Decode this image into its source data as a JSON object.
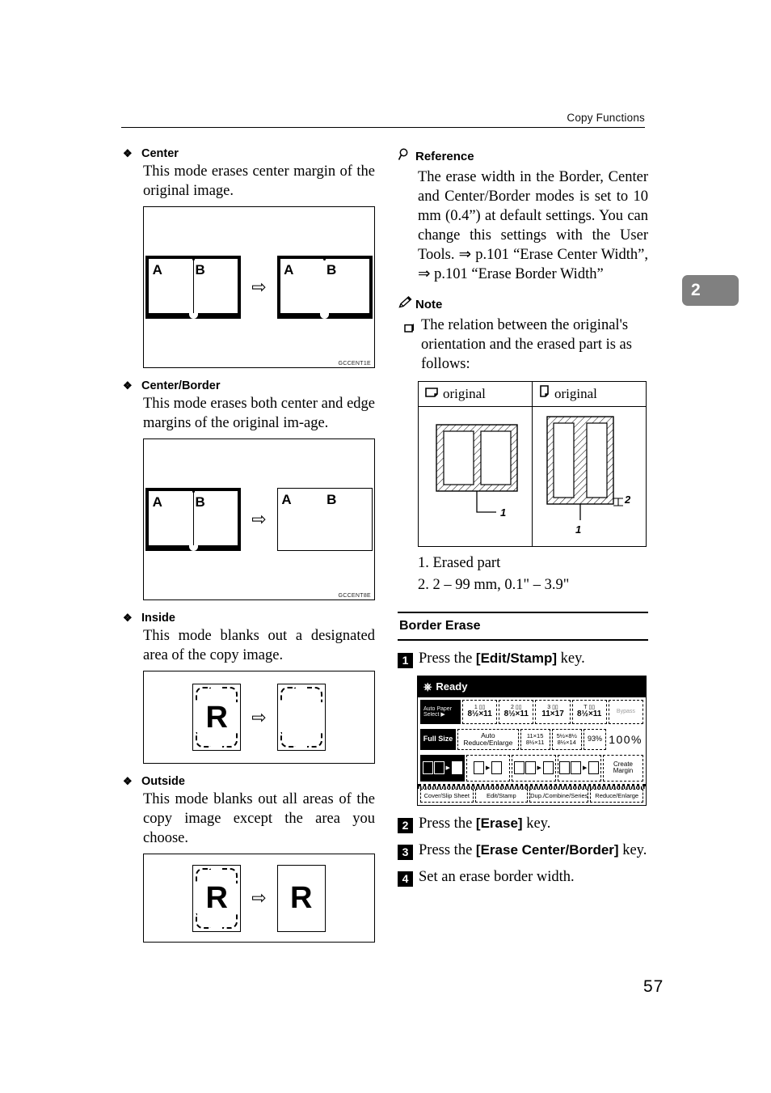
{
  "header": {
    "running_head": "Copy Functions"
  },
  "chapter_tab": {
    "number": "2"
  },
  "page_number": "57",
  "left_column": {
    "sections": [
      {
        "bullet": "❖",
        "title": "Center",
        "body": "This mode erases center margin of the original image.",
        "figure_caption": "GCCENT1E",
        "figure_letters": {
          "left": "A",
          "right": "B"
        },
        "arrow": "⇨"
      },
      {
        "bullet": "❖",
        "title": "Center/Border",
        "body": "This mode erases both center and edge margins of the original im-age.",
        "figure_caption": "GCCENT8E",
        "figure_letters": {
          "left": "A",
          "right": "B"
        },
        "arrow": "⇨"
      },
      {
        "bullet": "❖",
        "title": "Inside",
        "body": "This mode blanks out a designated area of the copy image.",
        "figure_caption": "",
        "figure_letter": "R",
        "arrow": "⇨"
      },
      {
        "bullet": "❖",
        "title": "Outside",
        "body": "This mode blanks out all areas of the copy image except the area you choose.",
        "figure_caption": "",
        "figure_letter": "R",
        "arrow": "⇨"
      }
    ]
  },
  "right_column": {
    "reference": {
      "icon": "magnifier-icon",
      "title": "Reference",
      "body": "The erase width in the Border, Center and Center/Border modes is set to 10 mm (0.4”) at default settings. You can change this settings with the User Tools. ⇒ p.101 “Erase Center Width”, ⇒ p.101 “Erase Border Width”"
    },
    "note": {
      "icon": "pencil-icon",
      "title": "Note",
      "bullet": "❑",
      "body": "The relation between the original's orientation and the erased part is as follows:",
      "table": {
        "headers": [
          {
            "icon": "page-landscape-icon",
            "label": "original"
          },
          {
            "icon": "page-portrait-icon",
            "label": "original"
          }
        ],
        "callouts_left": [
          "1"
        ],
        "callouts_right": [
          "1",
          "2"
        ]
      },
      "legend": [
        "1. Erased part",
        "2. 2 – 99 mm, 0.1\" – 3.9\""
      ]
    },
    "procedure": {
      "title": "Border Erase",
      "steps": [
        {
          "num": "1",
          "pre": "Press the ",
          "key": "[Edit/Stamp]",
          "post": " key."
        },
        {
          "num": "2",
          "pre": "Press the ",
          "key": "[Erase]",
          "post": " key."
        },
        {
          "num": "3",
          "pre": "Press the ",
          "key": "[Erase Center/Border]",
          "post": " key."
        },
        {
          "num": "4",
          "pre": "Set an erase border width.",
          "key": "",
          "post": ""
        }
      ]
    },
    "lcd": {
      "status_icon": "power-icon",
      "status": "Ready",
      "paper_row": [
        {
          "label_top": "Auto Paper",
          "label_bottom": "Select ▶",
          "selected": true
        },
        {
          "tray": "1",
          "size": "8½×11",
          "selected": false
        },
        {
          "tray": "2",
          "size": "8½×11",
          "selected": false
        },
        {
          "tray": "3",
          "size": "11×17",
          "selected": false
        },
        {
          "tray": "T",
          "size": "8½×11",
          "selected": false
        },
        {
          "tray": "",
          "size": "Bypass",
          "selected": false
        }
      ],
      "zoom_row": {
        "full_size": "Full Size",
        "auto_reduce": "Auto Reduce/Enlarge",
        "preset1_top": "11×15",
        "preset1_bottom": "8½×11",
        "preset2_top": "5½×8½",
        "preset2_bottom": "8½×14",
        "preset3": "93%",
        "current_zoom": "100%"
      },
      "duplex_row": {
        "keys": [
          "1 2 →",
          "→",
          "1 2 → 1 2",
          "1 2 → 1 2 3 4"
        ],
        "create_margin_top": "Create",
        "create_margin_bottom": "Margin"
      },
      "tabs": [
        "Cover/Slip Sheet",
        "Edit/Stamp",
        "Dup./Combine/Series",
        "Reduce/Enlarge"
      ]
    }
  }
}
